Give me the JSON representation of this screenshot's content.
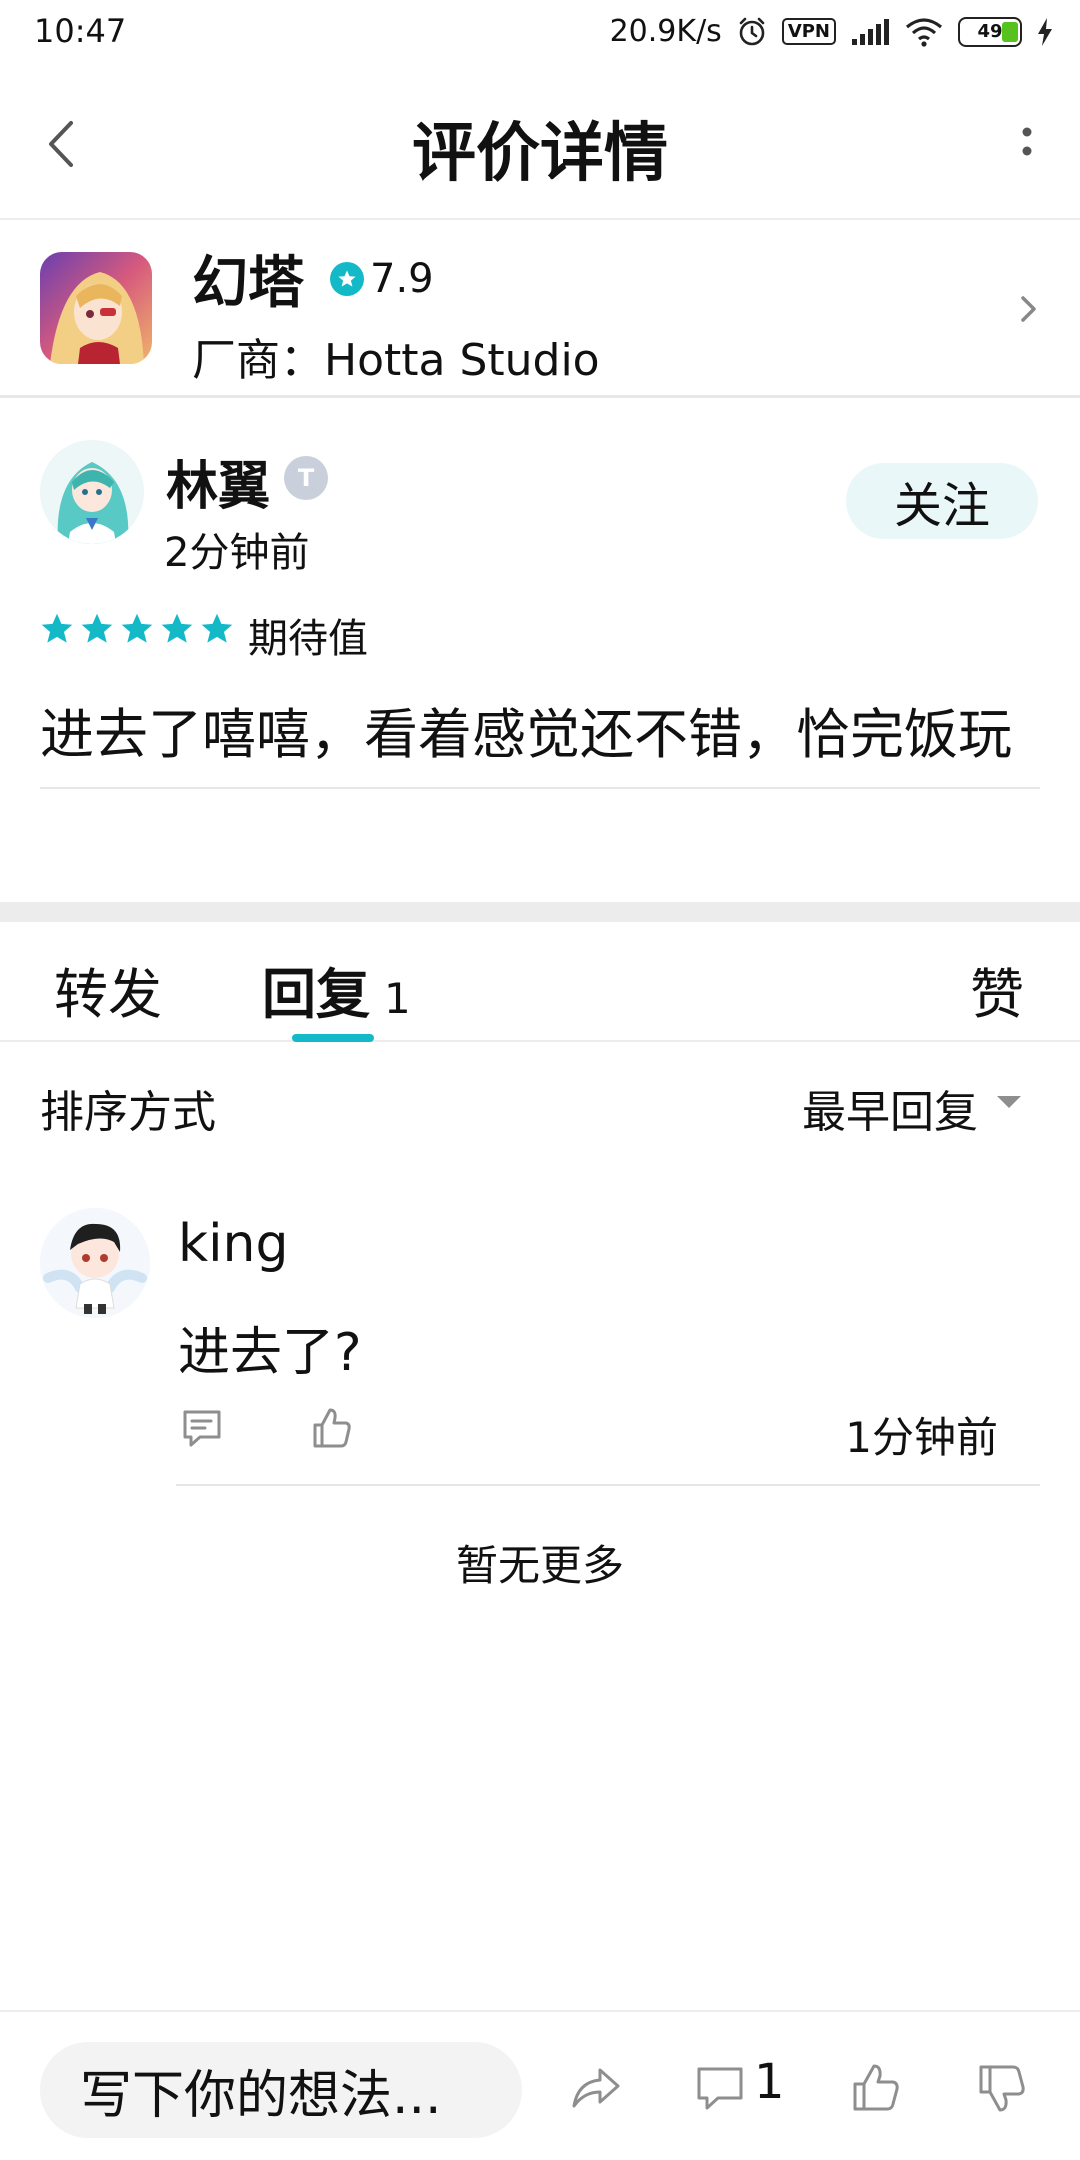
{
  "status_bar": {
    "time": "10:47",
    "network_speed": "20.9K/s",
    "vpn": "VPN",
    "battery": "49"
  },
  "header": {
    "title": "评价详情"
  },
  "app": {
    "name": "幻塔",
    "rating": "7.9",
    "vendor": "厂商：Hotta Studio"
  },
  "review": {
    "author": "林翼",
    "level_badge": "T",
    "time": "2分钟前",
    "follow_label": "关注",
    "stars": 5,
    "star_tag": "期待值",
    "text": "进去了嘻嘻，看着感觉还不错，恰完饭玩"
  },
  "tabs": {
    "repost": "转发",
    "reply": "回复",
    "reply_count": "1",
    "like": "赞"
  },
  "sort": {
    "label": "排序方式",
    "value": "最早回复"
  },
  "replies": [
    {
      "author": "king",
      "text": "进去了?",
      "time": "1分钟前"
    }
  ],
  "no_more": "暂无更多",
  "bottom_bar": {
    "compose_placeholder": "写下你的想法...",
    "comment_count": "1"
  },
  "colors": {
    "accent": "#14b9c8",
    "follow_bg": "#e9f7f9",
    "icon_gray": "#8e8e8e"
  }
}
